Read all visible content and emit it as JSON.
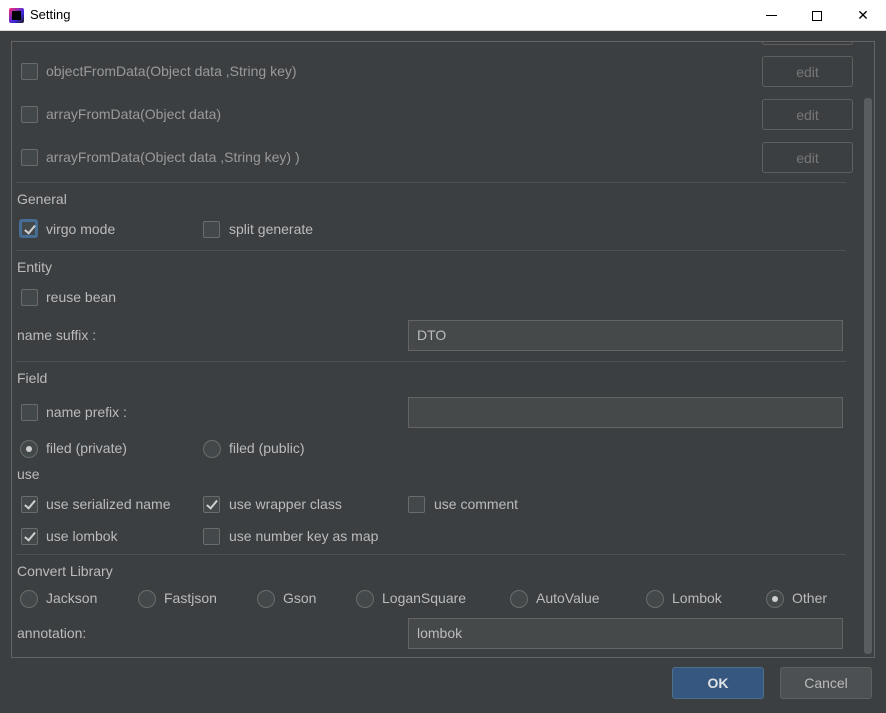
{
  "window": {
    "title": "Setting",
    "minimize_glyph": "",
    "close_glyph": "✕"
  },
  "methods": [
    {
      "label": "objectFromData(Object data ,String key)",
      "checked": false,
      "edit_label": "edit"
    },
    {
      "label": "arrayFromData(Object data)",
      "checked": false,
      "edit_label": "edit"
    },
    {
      "label": "arrayFromData(Object data ,String key) )",
      "checked": false,
      "edit_label": "edit"
    }
  ],
  "general": {
    "title": "General",
    "virgo_mode": {
      "label": "virgo mode",
      "checked": true
    },
    "split_generate": {
      "label": "split generate",
      "checked": false
    }
  },
  "entity": {
    "title": "Entity",
    "reuse_bean": {
      "label": "reuse bean",
      "checked": false
    },
    "name_suffix_label": "name suffix :",
    "name_suffix_value": "DTO"
  },
  "field": {
    "title": "Field",
    "name_prefix": {
      "label": "name prefix :",
      "checked": false,
      "value": ""
    },
    "filed_private": {
      "label": "filed (private)",
      "selected": true
    },
    "filed_public": {
      "label": "filed (public)",
      "selected": false
    },
    "use_title": "use",
    "use_serialized_name": {
      "label": "use serialized name",
      "checked": true
    },
    "use_wrapper_class": {
      "label": "use wrapper class",
      "checked": true
    },
    "use_comment": {
      "label": "use comment",
      "checked": false
    },
    "use_lombok": {
      "label": "use lombok",
      "checked": true
    },
    "use_number_key_as_map": {
      "label": "use number key as map",
      "checked": false
    }
  },
  "convert_library": {
    "title": "Convert Library",
    "options": [
      {
        "label": "Jackson",
        "selected": false
      },
      {
        "label": "Fastjson",
        "selected": false
      },
      {
        "label": "Gson",
        "selected": false
      },
      {
        "label": "LoganSquare",
        "selected": false
      },
      {
        "label": "AutoValue",
        "selected": false
      },
      {
        "label": "Lombok",
        "selected": false
      },
      {
        "label": "Other",
        "selected": true
      }
    ],
    "annotation_label": "annotation:",
    "annotation_value": "lombok"
  },
  "footer": {
    "ok_label": "OK",
    "cancel_label": "Cancel"
  },
  "colors": {
    "background": "#3c3f41",
    "ok_button": "#365880",
    "text": "#bbbbbb"
  }
}
